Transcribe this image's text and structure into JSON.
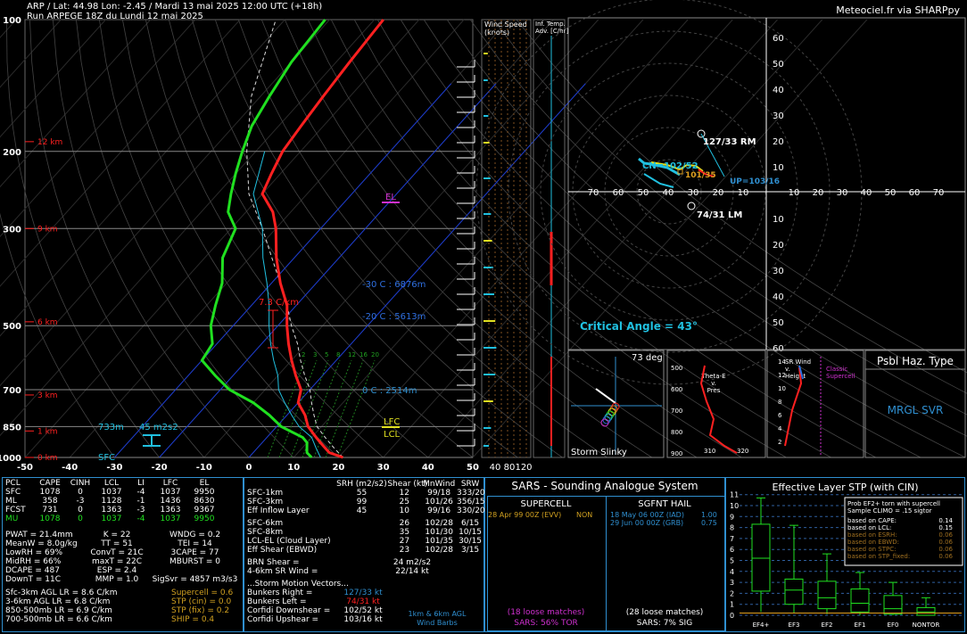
{
  "header": {
    "line1": "ARP / Lat: 44.98 Lon: -2.45 / Mardi 13 mai 2025 12:00 UTC (+18h)",
    "line2": "Run ARPEGE 18Z du Lundi 12 mai 2025",
    "brand": "Meteociel.fr via SHARPpy"
  },
  "colors": {
    "temp": "#ff2020",
    "dew": "#20e020",
    "wetbulb": "#20c0e0",
    "accent": "#2f8fd0",
    "el": "#d030d0",
    "lfc": "#e0e020"
  },
  "skewt": {
    "pressure_ticks": [
      "100",
      "200",
      "300",
      "500",
      "700",
      "850",
      "1000"
    ],
    "temp_ticks": [
      "-50",
      "-40",
      "-30",
      "-20",
      "-10",
      "0",
      "10",
      "20",
      "30",
      "40",
      "50"
    ],
    "height_labels": [
      "12 km",
      "9 km",
      "6 km",
      "3 km",
      "1 km",
      "0 km"
    ],
    "annotations": {
      "el": "EL",
      "lfc": "LFC",
      "lcl": "LCL",
      "lapse": "7.3 C/km",
      "iso30": "-30 C : 6876m",
      "iso20": "-20 C : 5613m",
      "iso0": "0 C : 2514m",
      "eff_base": "733m",
      "eff_srh": "45 m2s2",
      "sfc": "SFC"
    },
    "mixing_ratio": [
      "2",
      "3",
      "5",
      "8",
      "12",
      "16",
      "20"
    ]
  },
  "chart_data": [
    {
      "type": "line",
      "title": "",
      "xlabel": "",
      "ylabel": "",
      "xlim": [
        -50,
        50
      ],
      "ylim": [
        1000,
        100
      ],
      "y_scale": "log",
      "series": [
        {
          "p": [
            1000,
            975,
            950,
            925,
            900,
            850,
            800,
            750,
            700,
            650,
            600,
            550,
            500,
            450,
            400,
            350,
            300,
            275,
            250,
            225,
            200,
            175,
            150,
            125,
            100
          ],
          "t": [
            21,
            17,
            15,
            13,
            11,
            7,
            4,
            0,
            -2,
            -6,
            -10,
            -14,
            -18,
            -22,
            -28,
            -34,
            -40,
            -44,
            -50,
            -52,
            -54,
            -55,
            -56,
            -57,
            -58
          ]
        },
        {
          "p": [
            1000,
            975,
            950,
            925,
            900,
            850,
            800,
            750,
            700,
            650,
            600,
            550,
            500,
            450,
            400,
            350,
            300,
            275,
            250,
            225,
            200,
            175,
            150,
            125,
            100
          ],
          "td": [
            14,
            12,
            11,
            10,
            8,
            1,
            -4,
            -10,
            -18,
            -24,
            -30,
            -31,
            -35,
            -38,
            -41,
            -46,
            -49,
            -54,
            -57,
            -60,
            -63,
            -66,
            -68,
            -70,
            -71
          ]
        },
        {
          "p": [
            1000,
            950,
            900,
            850,
            800,
            750,
            700,
            650,
            600,
            550,
            500,
            450,
            400,
            350,
            300,
            250,
            200
          ],
          "tw": [
            16,
            13,
            10,
            5,
            1,
            -3,
            -7,
            -10,
            -14,
            -18,
            -22,
            -26,
            -31,
            -37,
            -43,
            -52,
            -58
          ]
        },
        {
          "p": [
            1000,
            950,
            900,
            850,
            800,
            750,
            700,
            650,
            600,
            550,
            500,
            450,
            400,
            350,
            300,
            250,
            200,
            150,
            100
          ],
          "parcel": [
            21,
            17,
            13,
            9,
            6,
            3,
            0,
            -4,
            -8,
            -12,
            -17,
            -22,
            -28,
            -35,
            -43,
            -53,
            -62,
            -72,
            -82
          ]
        }
      ]
    },
    {
      "type": "scatter",
      "title": "hodograph",
      "xlim": [
        -70,
        70
      ],
      "ylim": [
        -60,
        60
      ],
      "points_kt": [
        [
          -3,
          12
        ],
        [
          -10,
          14
        ],
        [
          -16,
          16
        ],
        [
          -22,
          13
        ],
        [
          -30,
          14
        ],
        [
          -40,
          12
        ],
        [
          -45,
          10
        ],
        [
          -52,
          12
        ],
        [
          -56,
          14
        ]
      ],
      "labels": [
        "127/33 RM",
        "74/31 LM",
        "CN=102/52",
        "101/35",
        "UP=103/16"
      ],
      "critical_angle": "Critical Angle = 43°"
    }
  ],
  "hodo": {
    "rings_top": [
      "60",
      "50",
      "40",
      "30",
      "20",
      "10"
    ],
    "rings_bottom": [
      "10",
      "20",
      "30",
      "40",
      "50",
      "60"
    ],
    "xaxis": [
      "70",
      "60",
      "50",
      "40",
      "30",
      "20",
      "10",
      "10",
      "20",
      "30",
      "40",
      "50",
      "60",
      "70"
    ],
    "rm": "127/33 RM",
    "lm": "74/31 LM",
    "cn": "CN=102/52",
    "m35": "101/35",
    "up": "UP=103/16",
    "critical": "Critical Angle = 43°"
  },
  "wind": {
    "title": "Wind Speed\n(knots)",
    "ticks": [
      "40",
      "80",
      "120"
    ],
    "inf_title": "Inf. Temp.\nAdv. [C/hr]"
  },
  "slinky": {
    "deg": "73 deg",
    "label": "Storm Slinky"
  },
  "theta": {
    "title": "Theta-E\nv.\nPres",
    "y": [
      "500",
      "600",
      "700",
      "800",
      "900"
    ],
    "x": [
      "310",
      "320"
    ]
  },
  "srwind": {
    "title": "SR Wind\nv.\nHeight",
    "classic": "Classic\nSupercell",
    "h": [
      "14",
      "12",
      "10",
      "8",
      "6",
      "4",
      "2"
    ]
  },
  "haz": {
    "title": "Psbl Haz. Type",
    "value": "MRGL SVR"
  },
  "parcels": {
    "headers": [
      "PCL",
      "CAPE",
      "CINH",
      "LCL",
      "LI",
      "LFC",
      "EL"
    ],
    "rows": [
      [
        "SFC",
        "1078",
        "0",
        "1037",
        "-4",
        "1037",
        "9950"
      ],
      [
        "ML",
        "358",
        "-3",
        "1128",
        "-1",
        "1436",
        "8630"
      ],
      [
        "FCST",
        "731",
        "0",
        "1363",
        "-3",
        "1363",
        "9367"
      ],
      [
        "MU",
        "1078",
        "0",
        "1037",
        "-4",
        "1037",
        "9950"
      ]
    ],
    "indices": [
      [
        "PWAT = 21.4mm",
        "K = 22",
        "WNDG = 0.2"
      ],
      [
        "MeanW = 8.0g/kg",
        "TT = 51",
        "TEI = 14"
      ],
      [
        "LowRH = 69%",
        "ConvT = 21C",
        "3CAPE = 77"
      ],
      [
        "MidRH = 66%",
        "maxT = 22C",
        "MBURST = 0"
      ],
      [
        "DCAPE = 487",
        "ESP = 2.4",
        ""
      ],
      [
        "DownT = 11C",
        "MMP = 1.0",
        "SigSvr = 4857 m3/s3"
      ]
    ],
    "lapse": [
      "Sfc-3km AGL LR = 8.6 C/km",
      "3-6km AGL LR = 6.8 C/km",
      "850-500mb LR = 6.9 C/km",
      "700-500mb LR = 6.6 C/km"
    ],
    "comp": [
      "Supercell = 0.6",
      "STP (cin) = 0.0",
      "STP (fix) = 0.2",
      "SHIP = 0.4"
    ]
  },
  "kinematics": {
    "headers": [
      "",
      "SRH (m2/s2)",
      "Shear (kt)",
      "MnWind",
      "SRW"
    ],
    "rows": [
      [
        "SFC-1km",
        "55",
        "12",
        "99/18",
        "333/20"
      ],
      [
        "SFC-3km",
        "99",
        "25",
        "101/26",
        "356/15"
      ],
      [
        "Eff Inflow Layer",
        "45",
        "10",
        "99/16",
        "330/20"
      ],
      [
        "SFC-6km",
        "",
        "26",
        "102/28",
        "6/15"
      ],
      [
        "SFC-8km",
        "",
        "35",
        "101/30",
        "10/15"
      ],
      [
        "LCL-EL (Cloud Layer)",
        "",
        "27",
        "101/35",
        "30/15"
      ],
      [
        "Eff Shear (EBWD)",
        "",
        "23",
        "102/28",
        "3/15"
      ]
    ],
    "brn": [
      "BRN Shear =",
      "24 m2/s2"
    ],
    "srw46": [
      "4-6km SR Wind =",
      "22/14 kt"
    ],
    "motion_title": "...Storm Motion Vectors...",
    "motions": [
      [
        "Bunkers Right =",
        "127/33 kt"
      ],
      [
        "Bunkers Left =",
        "74/31 kt"
      ],
      [
        "Corfidi Downshear =",
        "102/52 kt"
      ],
      [
        "Corfidi Upshear =",
        "103/16 kt"
      ]
    ],
    "barbs_label": "1km & 6km AGL\nWind Barbs"
  },
  "sars": {
    "title": "SARS - Sounding Analogue System",
    "supercell": "SUPERCELL",
    "hail": "SGFNT HAIL",
    "sc_match": [
      "28 Apr 99 00Z (EVV)",
      "NON"
    ],
    "hail_matches": [
      [
        "18 May 06 00Z (IAD)",
        "1.00"
      ],
      [
        "29 Jun 00 00Z (GRB)",
        "0.75"
      ]
    ],
    "sc_loose": "(18 loose matches)",
    "sc_tor": "SARS: 56% TOR",
    "hail_loose": "(28 loose matches)",
    "hail_sig": "SARS: 7% SIG"
  },
  "stp": {
    "title": "Effective Layer STP (with CIN)",
    "yticks": [
      "11",
      "10",
      "9",
      "8",
      "7",
      "6",
      "5",
      "4",
      "3",
      "2",
      "1",
      "0"
    ],
    "cats": [
      "EF4+",
      "EF3",
      "EF2",
      "EF1",
      "EF0",
      "NONTOR"
    ],
    "box": [
      {
        "min": 0.3,
        "q1": 2.2,
        "med": 5.2,
        "q3": 8.3,
        "max": 10.7
      },
      {
        "min": 0.2,
        "q1": 1.0,
        "med": 2.3,
        "q3": 3.3,
        "max": 8.2
      },
      {
        "min": 0.1,
        "q1": 0.6,
        "med": 1.6,
        "q3": 3.1,
        "max": 5.6
      },
      {
        "min": 0.0,
        "q1": 0.3,
        "med": 1.1,
        "q3": 2.4,
        "max": 3.9
      },
      {
        "min": 0.0,
        "q1": 0.1,
        "med": 0.6,
        "q3": 1.8,
        "max": 3.0
      },
      {
        "min": 0.0,
        "q1": 0.0,
        "med": 0.3,
        "q3": 0.7,
        "max": 1.6
      }
    ],
    "legend": [
      "Prob EF2+ torn with supercell",
      "Sample CLIMO = .15 sigtor"
    ],
    "probs": [
      [
        "based on CAPE:",
        "0.14"
      ],
      [
        "based on LCL:",
        "0.15"
      ],
      [
        "based on ESRH:",
        "0.06"
      ],
      [
        "based on EBWD:",
        "0.06"
      ],
      [
        "based on STPC:",
        "0.06"
      ],
      [
        "based on STP_fixed:",
        "0.06"
      ]
    ]
  }
}
